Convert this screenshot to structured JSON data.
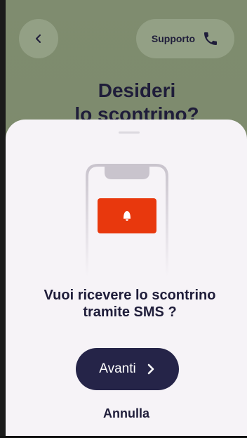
{
  "colors": {
    "background": "#7d8a6a",
    "sheet": "#f6f3f7",
    "primary_dark": "#252448",
    "accent_red": "#e8380d",
    "text": "#1f1d3a"
  },
  "header": {
    "back_icon": "chevron-left-icon",
    "support_label": "Supporto",
    "support_icon": "phone-icon"
  },
  "page": {
    "title_line1": "Desideri",
    "title_line2": "lo scontrino?"
  },
  "sheet": {
    "illustration": "phone-notification-illustration",
    "message_line1": "Vuoi ricevere lo scontrino",
    "message_line2": "tramite SMS ?",
    "primary_label": "Avanti",
    "primary_icon": "chevron-right-icon",
    "secondary_label": "Annulla"
  }
}
